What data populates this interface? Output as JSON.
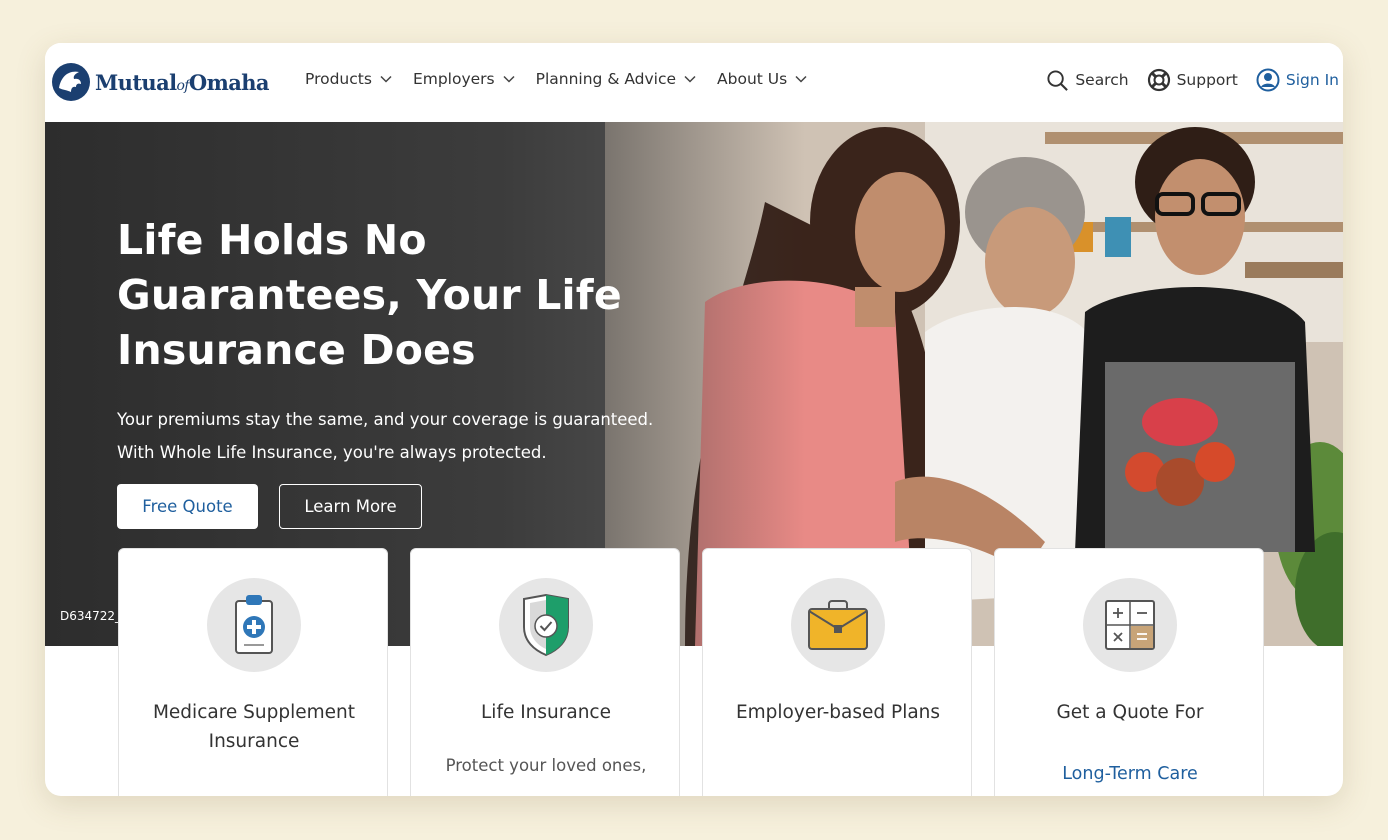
{
  "brand": {
    "logo_text_a": "Mutual",
    "logo_text_of": "of",
    "logo_text_b": "Omaha",
    "color": "#1b3f70"
  },
  "nav": {
    "items": [
      {
        "label": "Products",
        "icon": "chevron-down-icon"
      },
      {
        "label": "Employers",
        "icon": "chevron-down-icon"
      },
      {
        "label": "Planning & Advice",
        "icon": "chevron-down-icon"
      },
      {
        "label": "About Us",
        "icon": "chevron-down-icon"
      }
    ],
    "utilities": {
      "search": {
        "label": "Search",
        "icon": "search-icon"
      },
      "support": {
        "label": "Support",
        "icon": "support-icon"
      },
      "signin": {
        "label": "Sign In",
        "icon": "user-icon",
        "color": "#1f5f9e"
      }
    }
  },
  "hero": {
    "title": "Life Holds No Guarantees, Your Life Insurance Does",
    "subtitle_line1": "Your premiums stay the same, and your coverage is guaranteed.",
    "subtitle_line2": "With Whole Life Insurance, you're always protected.",
    "primary_button": "Free Quote",
    "secondary_button": "Learn More",
    "image_code": "D634722_"
  },
  "cards": [
    {
      "title": "Medicare Supplement Insurance",
      "icon": "clipboard-medical-icon"
    },
    {
      "title": "Life Insurance",
      "description": "Protect your loved ones,",
      "icon": "shield-check-icon"
    },
    {
      "title": "Employer-based Plans",
      "icon": "briefcase-icon"
    },
    {
      "title": "Get a Quote For",
      "link": "Long-Term Care",
      "icon": "calculator-icon"
    }
  ],
  "colors": {
    "accent": "#1f5f9e",
    "page_background": "#f6f0dc"
  }
}
